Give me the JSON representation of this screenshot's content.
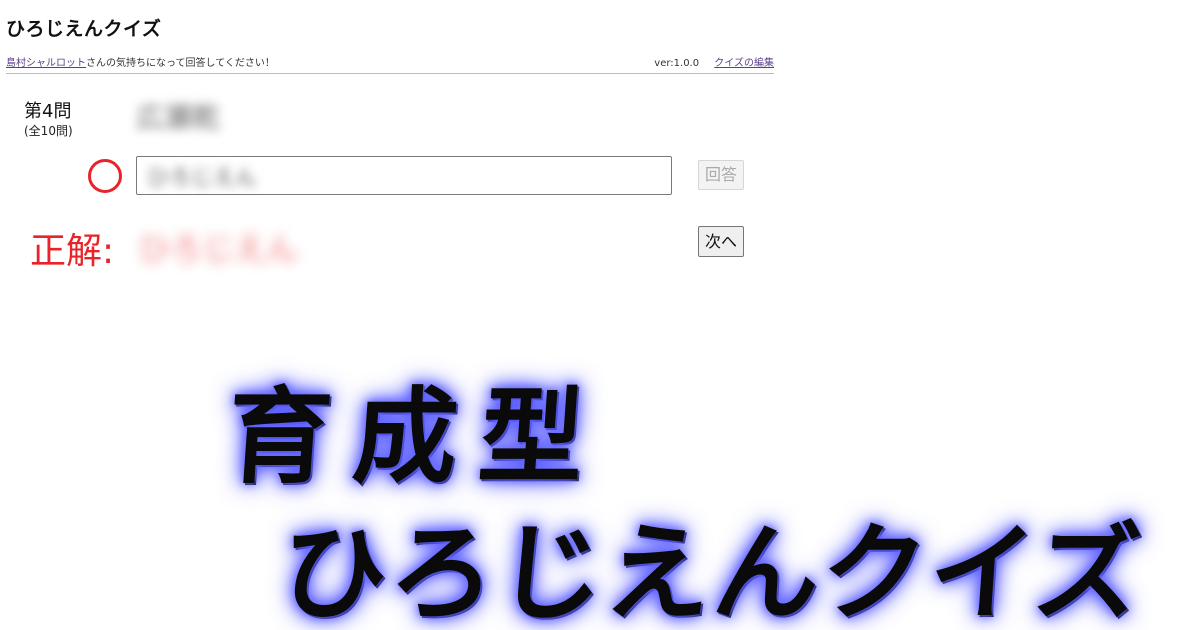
{
  "app": {
    "title": "ひろじえんクイズ"
  },
  "subheader": {
    "user_link": "島村シャルロット",
    "instruction": "さんの気持ちになって回答してください！",
    "version": "ver:1.0.0",
    "edit_link": "クイズの編集"
  },
  "question": {
    "number_label": "第4問",
    "total_label": "(全10問)",
    "text": "広瀬乾"
  },
  "answer": {
    "value": "ひろじえん",
    "button_label": "回答",
    "result_mark": "○",
    "button_enabled": false
  },
  "correct": {
    "label": "正解:",
    "value": "ひろじえん"
  },
  "next_button_label": "次へ",
  "logo": {
    "line1": "育成型",
    "line2": "ひろじえんクイズ"
  },
  "colors": {
    "accent_red": "#e8242a",
    "link_purple": "#5b3f8c",
    "glow_blue": "#4f52ff"
  }
}
